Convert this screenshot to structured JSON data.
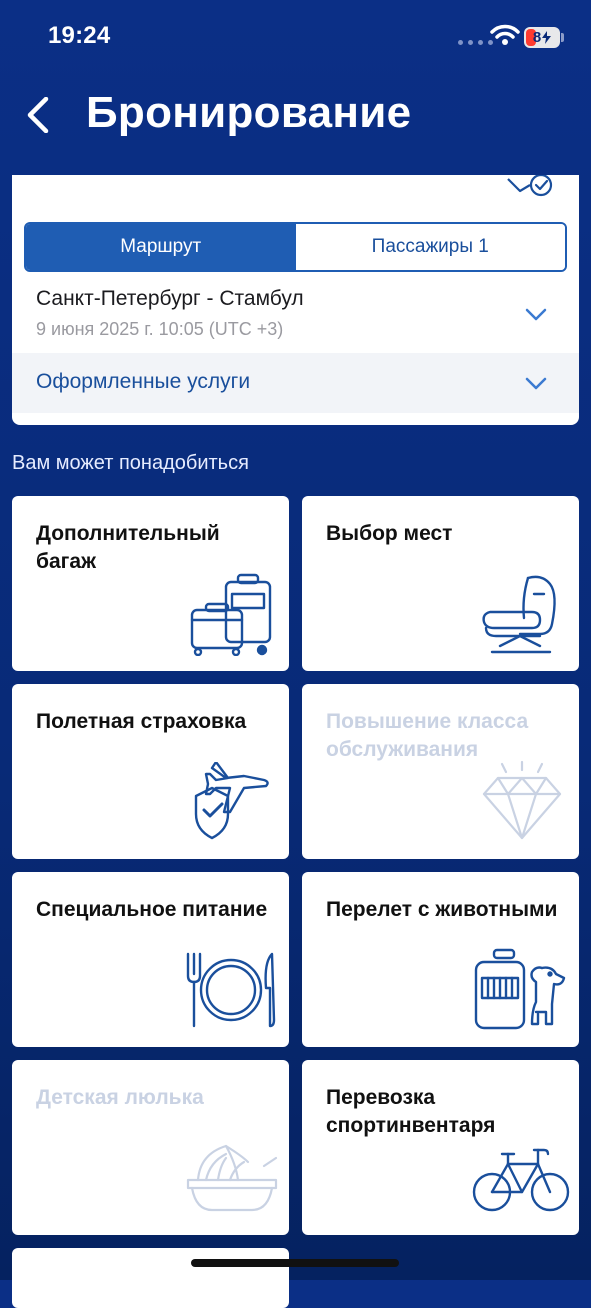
{
  "status_bar": {
    "time": "19:24",
    "battery": "8"
  },
  "header": {
    "title": "Бронирование"
  },
  "booking": {
    "tabs": [
      {
        "label": "Маршрут",
        "active": true
      },
      {
        "label": "Пассажиры 1",
        "active": false
      }
    ],
    "route": {
      "title": "Санкт-Петербург - Стамбул",
      "subtitle": "9 июня 2025 г. 10:05 (UTC +3)"
    },
    "services_label": "Оформленные услуги"
  },
  "section_title": "Вам может понадобиться",
  "tiles": [
    {
      "label": "Дополнительный багаж",
      "icon": "luggage-icon",
      "enabled": true
    },
    {
      "label": "Выбор мест",
      "icon": "seat-icon",
      "enabled": true
    },
    {
      "label": "Полетная страховка",
      "icon": "insurance-plane-icon",
      "enabled": true
    },
    {
      "label": "Повышение класса обслуживания",
      "icon": "diamond-icon",
      "enabled": false
    },
    {
      "label": "Специальное питание",
      "icon": "meal-icon",
      "enabled": true
    },
    {
      "label": "Перелет с животными",
      "icon": "pet-carrier-icon",
      "enabled": true
    },
    {
      "label": "Детская люлька",
      "icon": "cradle-icon",
      "enabled": false
    },
    {
      "label": "Перевозка спортинвентаря",
      "icon": "bicycle-icon",
      "enabled": true
    }
  ],
  "colors": {
    "brand_blue": "#1f5db3",
    "icon_blue": "#1a4f9c",
    "background": "#0b2f86",
    "disabled": "#c9d2e3"
  }
}
